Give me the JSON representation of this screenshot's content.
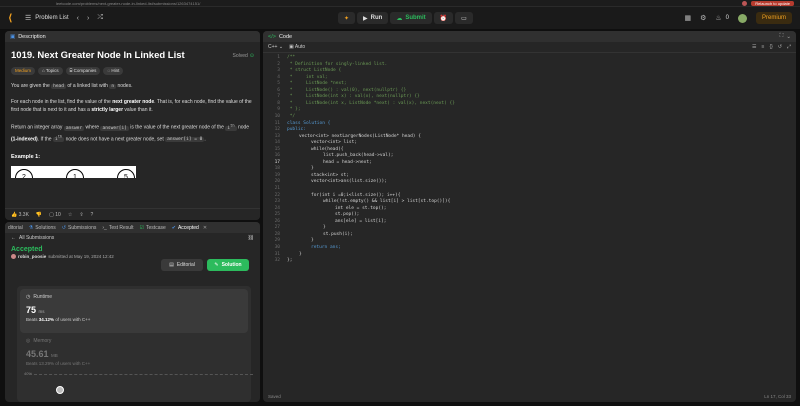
{
  "browser": {
    "url": "leetcode.com/problems/next-greater-node-in-linked-list/submissions/1263474151/",
    "update_label": "Relaunch to update"
  },
  "nav": {
    "problem_list": "Problem List",
    "run_label": "Run",
    "submit_label": "Submit",
    "streak": "0",
    "premium": "Premium"
  },
  "description": {
    "header": "Description",
    "title": "1019. Next Greater Node In Linked List",
    "solved": "Solved",
    "tags": [
      "Medium",
      "Topics",
      "Companies",
      "Hint"
    ],
    "p1_a": "You are given the",
    "p1_code1": "head",
    "p1_b": "of a linked list with",
    "p1_code2": "n",
    "p1_c": "nodes.",
    "p2_a": "For each node in the list, find the value of the",
    "p2_b1": "next greater node",
    "p2_c": ". That is, for each node, find the value of the first node that is next to it and has a",
    "p2_b2": "strictly larger",
    "p2_d": "value than it.",
    "p3_a": "Return an integer array",
    "p3_code1": "answer",
    "p3_b": "where",
    "p3_code2": "answer[i]",
    "p3_c": "is the value of the next greater node of the",
    "p3_sup1": "i",
    "p3_th1": "th",
    "p3_d": "node",
    "p3_bold": "(1-indexed)",
    "p3_e": ". If the",
    "p3_sup2": "i",
    "p3_th2": "th",
    "p3_f": "node does not have a next greater node, set",
    "p3_code3": "answer[i] = 0",
    "p3_g": ".",
    "example": "Example 1:",
    "example_nodes": [
      "2",
      "1",
      "5"
    ],
    "likes": "3.3K",
    "comments": "10"
  },
  "result": {
    "tabs": [
      "ditorial",
      "Solutions",
      "Submissions",
      "Test Result",
      "Testcase",
      "Accepted"
    ],
    "all_submissions": "All Submissions",
    "status": "Accepted",
    "user": "robin_poosie",
    "submitted_text": "submitted at May 19, 2024 12:42",
    "editorial_btn": "Editorial",
    "solution_btn": "Solution",
    "runtime_label": "Runtime",
    "runtime_value": "75",
    "runtime_unit": "ms",
    "runtime_beats_a": "Beats",
    "runtime_beats_pct": "34.12%",
    "runtime_beats_b": "of users with C++",
    "memory_label": "Memory",
    "memory_value": "45.61",
    "memory_unit": "MB",
    "memory_beats": "Beats 13.29% of users with C++",
    "dist_label": "40%"
  },
  "code": {
    "header": "Code",
    "language": "C++",
    "auto": "Auto",
    "saved": "Saved",
    "cursor": "Ln 17, Col 33",
    "current_line": 17,
    "lines": [
      {
        "n": "1",
        "t": "/**",
        "c": "comment",
        "i": 0
      },
      {
        "n": "2",
        "t": " * Definition for singly-linked list.",
        "c": "comment",
        "i": 0
      },
      {
        "n": "3",
        "t": " * struct ListNode {",
        "c": "comment",
        "i": 0
      },
      {
        "n": "4",
        "t": " *     int val;",
        "c": "comment",
        "i": 0
      },
      {
        "n": "5",
        "t": " *     ListNode *next;",
        "c": "comment",
        "i": 0
      },
      {
        "n": "6",
        "t": " *     ListNode() : val(0), next(nullptr) {}",
        "c": "comment",
        "i": 0
      },
      {
        "n": "7",
        "t": " *     ListNode(int x) : val(x), next(nullptr) {}",
        "c": "comment",
        "i": 0
      },
      {
        "n": "8",
        "t": " *     ListNode(int x, ListNode *next) : val(x), next(next) {}",
        "c": "comment",
        "i": 0
      },
      {
        "n": "9",
        "t": " * };",
        "c": "comment",
        "i": 0
      },
      {
        "n": "10",
        "t": " */",
        "c": "comment",
        "i": 0
      },
      {
        "n": "11",
        "t": "class Solution {",
        "c": "kw",
        "i": 0
      },
      {
        "n": "12",
        "t": "public:",
        "c": "kw",
        "i": 0
      },
      {
        "n": "13",
        "t": "vector<int> nextLargerNodes(ListNode* head) {",
        "c": "plain",
        "i": 1
      },
      {
        "n": "14",
        "t": "vector<int> list;",
        "c": "plain",
        "i": 2
      },
      {
        "n": "15",
        "t": "while(head){",
        "c": "plain",
        "i": 2
      },
      {
        "n": "16",
        "t": "list.push_back(head->val);",
        "c": "plain",
        "i": 3
      },
      {
        "n": "17",
        "t": "head = head->next;",
        "c": "plain",
        "i": 3
      },
      {
        "n": "18",
        "t": "}",
        "c": "plain",
        "i": 2
      },
      {
        "n": "19",
        "t": "stack<int> st;",
        "c": "plain",
        "i": 2
      },
      {
        "n": "20",
        "t": "vector<int>ans(list.size());",
        "c": "plain",
        "i": 2
      },
      {
        "n": "21",
        "t": "",
        "c": "plain",
        "i": 0
      },
      {
        "n": "22",
        "t": "for(int i =0;i<list.size(); i++){",
        "c": "plain",
        "i": 2
      },
      {
        "n": "23",
        "t": "while(!st.empty() && list[i] > list[st.top()]){",
        "c": "plain",
        "i": 3
      },
      {
        "n": "24",
        "t": "int ele = st.top();",
        "c": "plain",
        "i": 4
      },
      {
        "n": "25",
        "t": "st.pop();",
        "c": "plain",
        "i": 4
      },
      {
        "n": "26",
        "t": "ans[ele] = list[i];",
        "c": "plain",
        "i": 4
      },
      {
        "n": "27",
        "t": "}",
        "c": "plain",
        "i": 3
      },
      {
        "n": "28",
        "t": "st.push(i);",
        "c": "plain",
        "i": 3
      },
      {
        "n": "29",
        "t": "}",
        "c": "plain",
        "i": 2
      },
      {
        "n": "30",
        "t": "return ans;",
        "c": "kw",
        "i": 2
      },
      {
        "n": "31",
        "t": "}",
        "c": "plain",
        "i": 1
      },
      {
        "n": "32",
        "t": "};",
        "c": "plain",
        "i": 0
      }
    ]
  },
  "icons": {
    "logo": "leetcode-logo-icon",
    "list": "list-icon",
    "prev": "chevron-left-icon",
    "next": "chevron-right-icon",
    "shuffle": "shuffle-icon"
  }
}
